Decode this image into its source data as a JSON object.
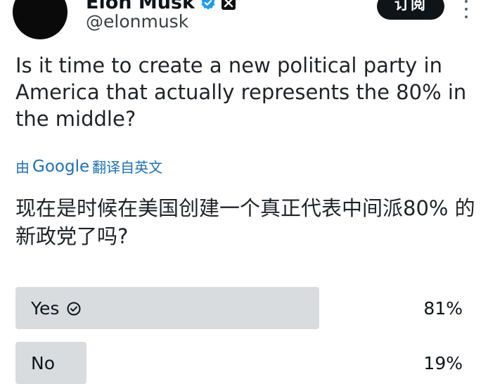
{
  "author": {
    "display_name": "Elon Musk",
    "handle": "@elonmusk"
  },
  "header": {
    "subscribe_label": "订阅"
  },
  "tweet": {
    "text": "Is it time to create a new political party in America that actually represents the 80% in the middle?"
  },
  "translation": {
    "prefix": "由",
    "provider": "Google",
    "suffix": "翻译自英文",
    "text": "现在是时候在美国创建一个真正代表中间派80% 的新政党了吗?"
  },
  "poll": {
    "options": [
      {
        "label": "Yes",
        "percent": "81%",
        "share": 0.81,
        "selected": true
      },
      {
        "label": "No",
        "percent": "19%",
        "share": 0.19,
        "selected": false
      }
    ]
  },
  "colors": {
    "bar": "#d9dcdf",
    "verified": "#1d9bf0",
    "link": "#1d6fb8"
  },
  "icons": {
    "verified": "verified-badge-icon",
    "affiliate": "x-affiliate-icon",
    "more": "more-vertical-icon",
    "selected": "check-circle-icon"
  }
}
